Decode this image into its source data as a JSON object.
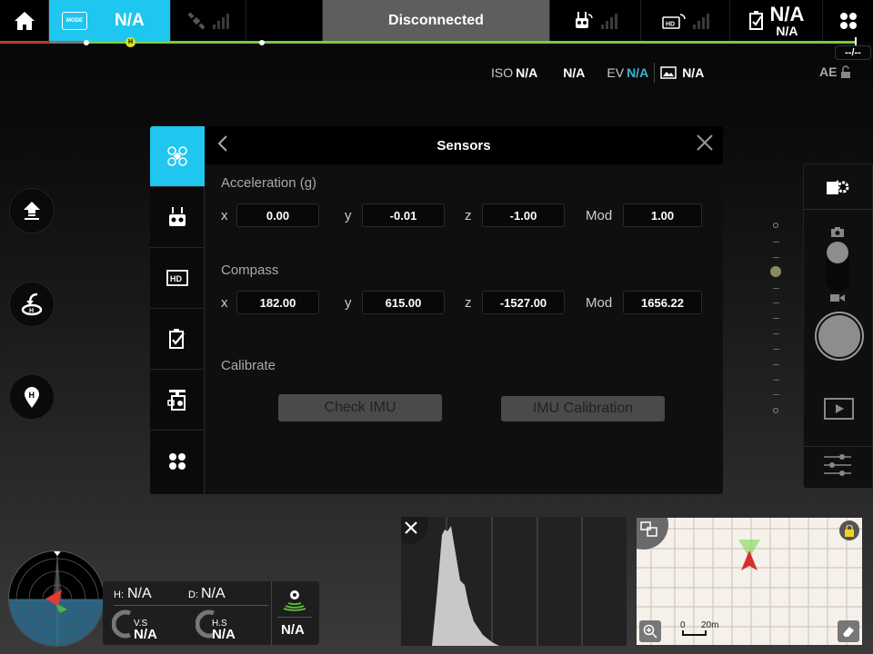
{
  "topbar": {
    "home_icon": "home-icon",
    "mode_badge": "MODE",
    "mode_value": "N/A",
    "gps_icon": "satellite-icon",
    "status": "Disconnected",
    "rc_icon": "remote-controller-icon",
    "hd_icon": "hd-video-link-icon",
    "battery_icon": "battery-icon",
    "battery_value": "N/A",
    "battery_sub": "N/A",
    "menu_icon": "menu-dots-icon",
    "flight_time": "--/--",
    "home_marker": "H"
  },
  "camera_params": {
    "iso_label": "ISO",
    "iso_value": "N/A",
    "shutter_value": "N/A",
    "ev_label": "EV",
    "ev_value": "N/A",
    "storage_value": "N/A",
    "ae_label": "AE"
  },
  "left_buttons": [
    "takeoff",
    "return-to-home",
    "home-point"
  ],
  "dialog": {
    "title": "Sensors",
    "nav": [
      "aircraft",
      "remote-controller",
      "hd-link",
      "battery",
      "gimbal-camera",
      "more"
    ],
    "acceleration": {
      "label": "Acceleration (g)",
      "x": "0.00",
      "y": "-0.01",
      "z": "-1.00",
      "mod": "1.00"
    },
    "compass": {
      "label": "Compass",
      "x": "182.00",
      "y": "615.00",
      "z": "-1527.00",
      "mod": "1656.22"
    },
    "axis_labels": {
      "x": "x",
      "y": "y",
      "z": "z",
      "mod": "Mod"
    },
    "calibrate": {
      "label": "Calibrate",
      "check_imu": "Check IMU",
      "imu_calibration": "IMU Calibration"
    }
  },
  "telemetry": {
    "h_label": "H:",
    "h_value": "N/A",
    "d_label": "D:",
    "d_value": "N/A",
    "vs_label": "V.S",
    "vs_value": "N/A",
    "hs_label": "H.S",
    "hs_value": "N/A",
    "signal_value": "N/A"
  },
  "minimap": {
    "scale_zero": "0",
    "scale_label": "20m"
  }
}
